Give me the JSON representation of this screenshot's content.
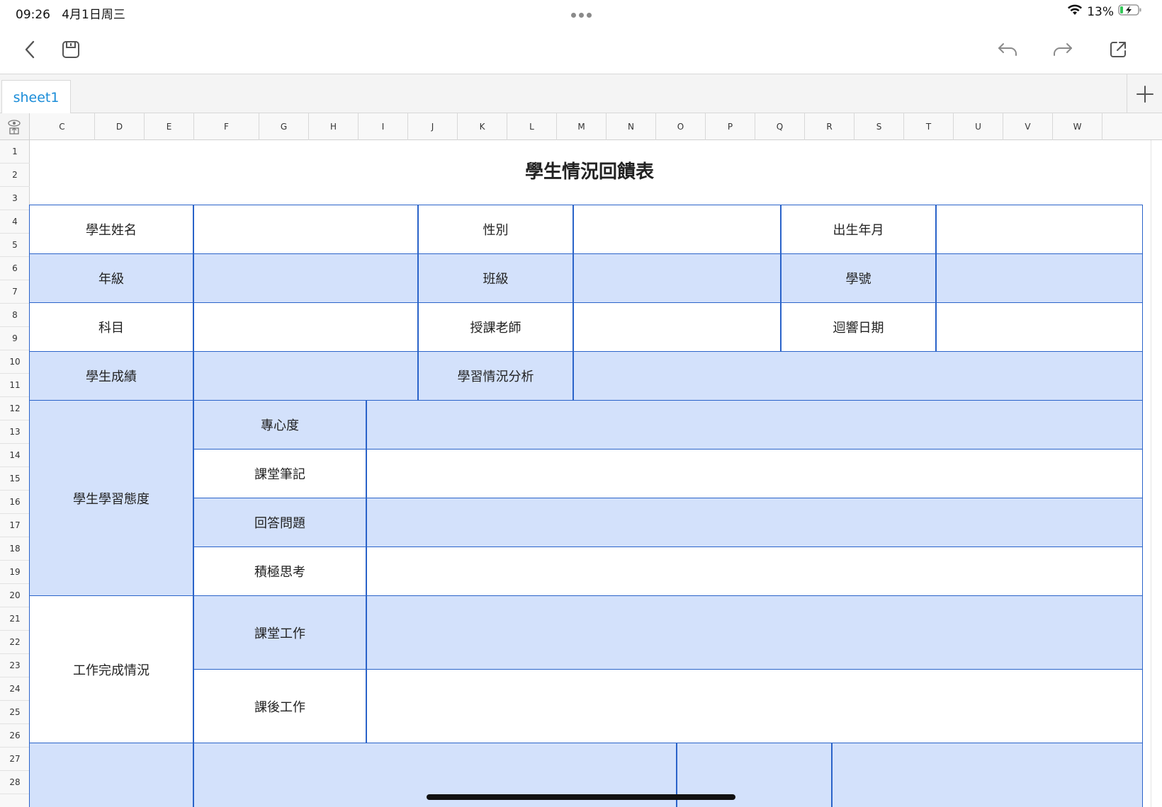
{
  "status": {
    "time": "09:26",
    "date": "4月1日周三",
    "battery": "13%"
  },
  "tabs": [
    {
      "label": "sheet1",
      "active": true
    }
  ],
  "columns": [
    "C",
    "D",
    "E",
    "F",
    "G",
    "H",
    "I",
    "J",
    "K",
    "L",
    "M",
    "N",
    "O",
    "P",
    "Q",
    "R",
    "S",
    "T",
    "U",
    "V",
    "W"
  ],
  "rows": [
    "1",
    "2",
    "3",
    "4",
    "5",
    "6",
    "7",
    "8",
    "9",
    "10",
    "11",
    "12",
    "13",
    "14",
    "15",
    "16",
    "17",
    "18",
    "19",
    "20",
    "21",
    "22",
    "23",
    "24",
    "25",
    "26",
    "27",
    "28"
  ],
  "form": {
    "title": "學生情況回饋表",
    "student_name": "學生姓名",
    "gender": "性別",
    "birth": "出生年月",
    "grade": "年級",
    "class": "班級",
    "student_id": "學號",
    "subject": "科目",
    "teacher": "授課老師",
    "feedback_date": "迴響日期",
    "score": "學生成績",
    "analysis": "學習情況分析",
    "attitude": "學生學習態度",
    "focus": "專心度",
    "notes": "課堂筆記",
    "answering": "回答問題",
    "thinking": "積極思考",
    "work": "工作完成情況",
    "class_work": "課堂工作",
    "homework": "課後工作"
  },
  "colors": {
    "accent": "#1a8cd8",
    "cell_blue": "#d3e1fb",
    "border_blue": "#2a63c9"
  }
}
